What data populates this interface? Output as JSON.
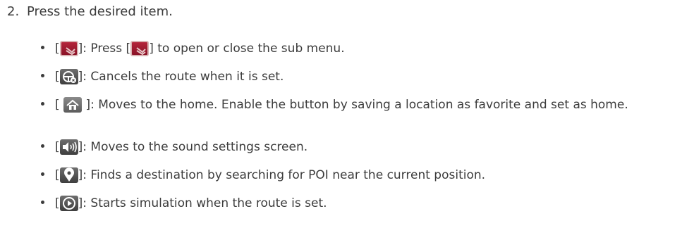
{
  "step": {
    "number": "2.",
    "text": "Press the desired item."
  },
  "icons": {
    "submenu": "submenu-icon",
    "cancel_route": "cancel-route-icon",
    "home": "home-icon",
    "sound": "speaker-icon",
    "poi": "location-pin-icon",
    "simulation": "play-icon"
  },
  "colors": {
    "submenu_red": "#9e1b30",
    "icon_dark": "#4a4a4a",
    "text": "#3c3c3c"
  },
  "items": [
    {
      "pre": "]: Press [",
      "post": "] to open or close the sub menu."
    },
    {
      "text": "]: Cancels the route when it is set."
    },
    {
      "text": "]: Moves to the home. Enable the button  by saving a location as favorite and set as home."
    },
    {
      "text": "]: Moves to the sound settings screen."
    },
    {
      "text": "]: Finds a destination by searching for POI near the current position."
    },
    {
      "text": "]: Starts simulation when the route is set."
    }
  ]
}
